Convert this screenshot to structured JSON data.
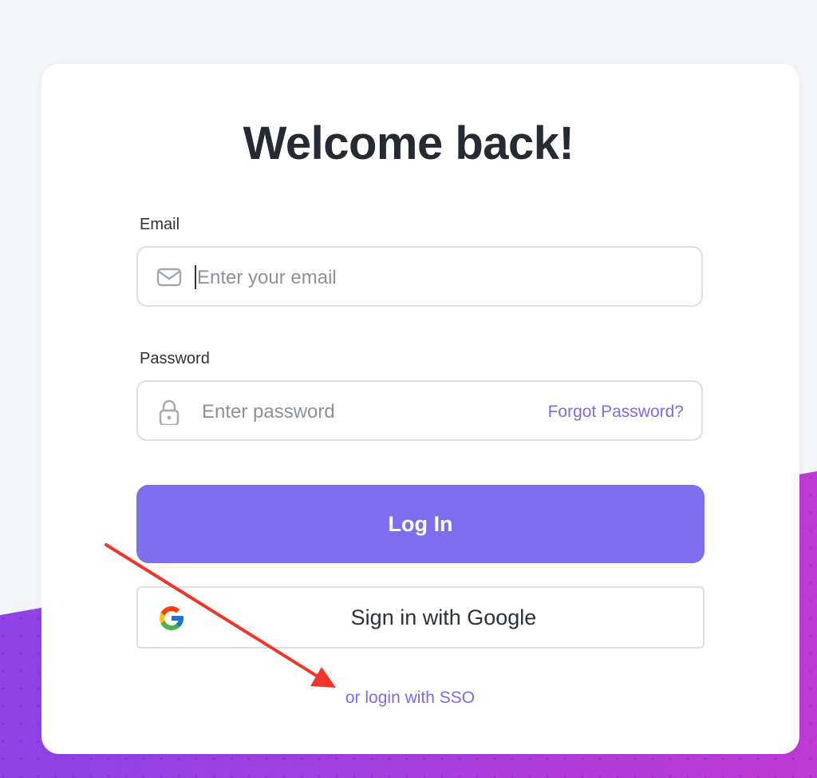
{
  "title": "Welcome back!",
  "email": {
    "label": "Email",
    "placeholder": "Enter your email",
    "icon": "mail-icon"
  },
  "password": {
    "label": "Password",
    "placeholder": "Enter password",
    "icon": "lock-icon",
    "forgot_label": "Forgot Password?"
  },
  "login_button": "Log In",
  "google_button": {
    "label": "Sign in with Google",
    "icon": "google-icon"
  },
  "sso_link": "or login with SSO",
  "annotation": {
    "icon": "red-arrow-icon",
    "color": "#f0362a"
  },
  "colors": {
    "accent": "#7b6fee",
    "link": "#7b6be9",
    "background_gradient_start": "#8e44e6",
    "background_gradient_end": "#c03ad6"
  }
}
